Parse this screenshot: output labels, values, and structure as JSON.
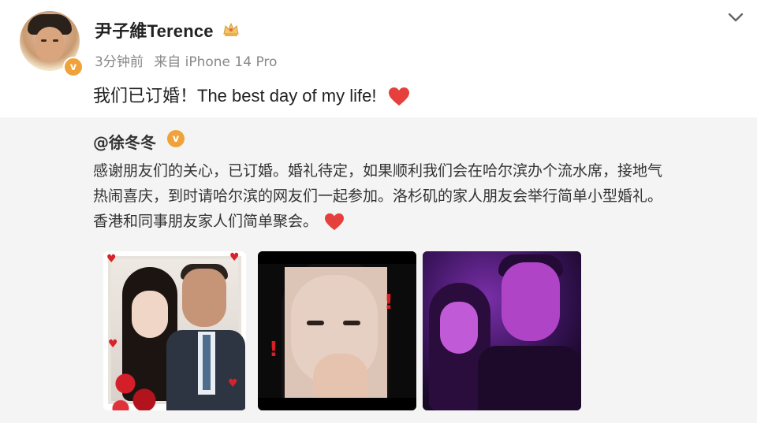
{
  "post": {
    "username": "尹子維Terence",
    "time": "3分钟前",
    "source": "来自 iPhone 14 Pro",
    "text": "我们已订婚！The best day of my life!"
  },
  "repost": {
    "username": "@徐冬冬",
    "lines": [
      "感谢朋友们的关心，已订婚。婚礼待定，如果顺利我们会在哈尔滨办个流水席，接地气",
      "热闹喜庆，到时请哈尔滨的网友们一起参加。洛杉矶的家人朋友会举行简单小型婚礼。",
      "香港和同事朋友家人们简单聚会。"
    ]
  },
  "icons": {
    "verified": "verified-badge-icon",
    "crown": "crown-icon",
    "heart": "heart-icon",
    "menu": "chevron-down-icon"
  },
  "colors": {
    "verified_orange": "#f0a23a",
    "heart_red": "#e5403c",
    "repost_bg": "#f4f4f4",
    "meta_gray": "#888888"
  }
}
